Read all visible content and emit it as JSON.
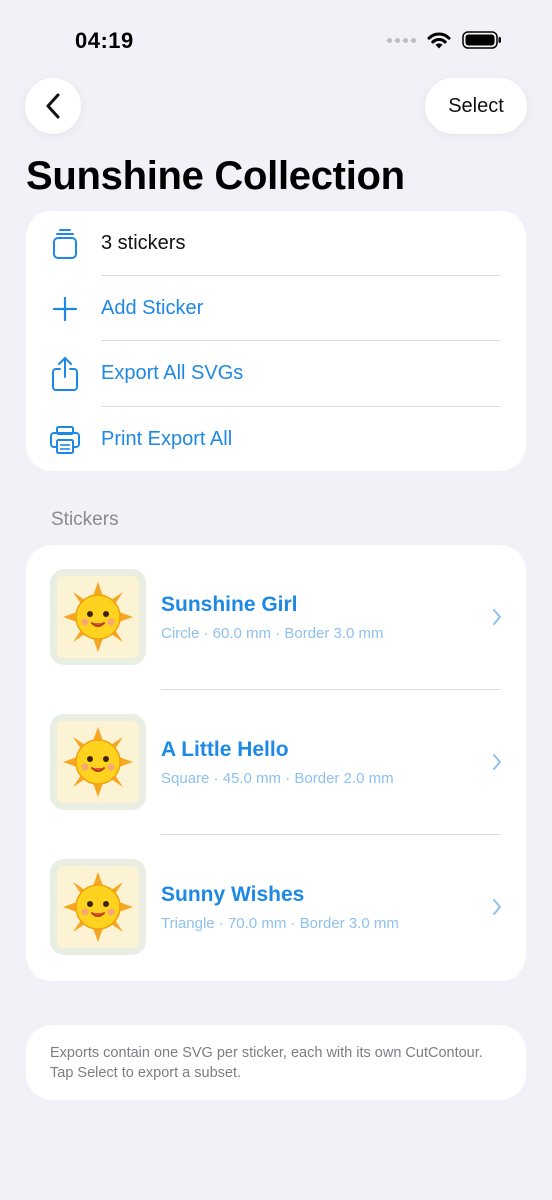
{
  "status_bar": {
    "time": "04:19"
  },
  "nav": {
    "select_label": "Select"
  },
  "title": "Sunshine Collection",
  "actions": {
    "count_label": "3 stickers",
    "add_label": "Add Sticker",
    "export_label": "Export All SVGs",
    "print_label": "Print Export All"
  },
  "section_header": "Stickers",
  "stickers": [
    {
      "name": "Sunshine Girl",
      "meta": "Circle · 60.0 mm · Border 3.0 mm"
    },
    {
      "name": "A Little Hello",
      "meta": "Square · 45.0 mm · Border 2.0 mm"
    },
    {
      "name": "Sunny Wishes",
      "meta": "Triangle · 70.0 mm · Border 3.0 mm"
    }
  ],
  "footnote": "Exports contain one SVG per sticker, each with its own CutContour. Tap Select to export a subset.",
  "colors": {
    "accent": "#1E88E5",
    "background": "#F1F1F7",
    "card": "#FFFFFF"
  }
}
